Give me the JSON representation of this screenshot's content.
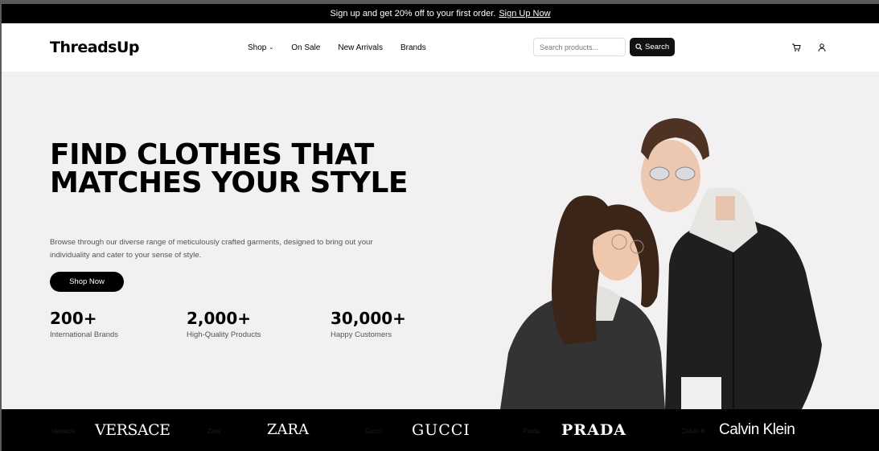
{
  "announcement": {
    "text": "Sign up and get 20% off to your first order.",
    "link": "Sign Up Now"
  },
  "header": {
    "logo": "ThreadsUp",
    "nav": [
      {
        "label": "Shop",
        "has_dropdown": true
      },
      {
        "label": "On Sale"
      },
      {
        "label": "New Arrivals"
      },
      {
        "label": "Brands"
      }
    ],
    "search_placeholder": "Search products...",
    "search_button": "Search",
    "icons": [
      "cart-icon",
      "user-icon"
    ]
  },
  "hero": {
    "title": "FIND CLOTHES THAT MATCHES YOUR STYLE",
    "description": "Browse through our diverse range of meticulously crafted garments, designed to bring out your individuality and cater to your sense of style.",
    "cta": "Shop Now",
    "stats": [
      {
        "value": "200+",
        "label": "International Brands"
      },
      {
        "value": "2,000+",
        "label": "High-Quality Products"
      },
      {
        "value": "30,000+",
        "label": "Happy Customers"
      }
    ]
  },
  "brands": {
    "logos": [
      "VERSACE",
      "ZARA",
      "GUCCI",
      "PRADA",
      "Calvin Klein"
    ],
    "faint_labels": [
      "Versace",
      "Zara",
      "Gucci",
      "Prada",
      "Calvin K"
    ]
  },
  "colors": {
    "primary": "#000000",
    "hero_bg": "#f2f0f1"
  }
}
